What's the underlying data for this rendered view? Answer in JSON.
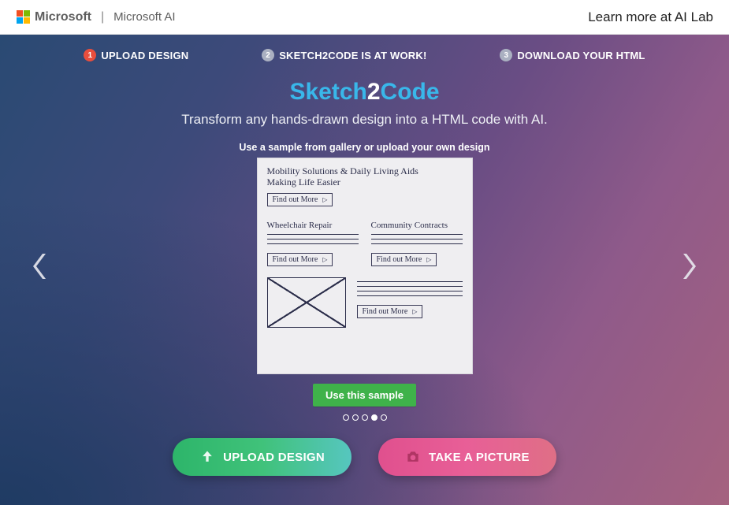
{
  "header": {
    "brand": "Microsoft",
    "subbrand": "Microsoft AI",
    "learn_more": "Learn more at AI Lab"
  },
  "steps": [
    {
      "num": "1",
      "label": "UPLOAD DESIGN",
      "active": true
    },
    {
      "num": "2",
      "label": "SKETCH2CODE IS AT WORK!",
      "active": false
    },
    {
      "num": "3",
      "label": "DOWNLOAD YOUR HTML",
      "active": false
    }
  ],
  "title": {
    "p1": "Sketch",
    "p2": "2",
    "p3": "Code"
  },
  "subtitle": "Transform any hands-drawn design into a HTML code with AI.",
  "gallery_hint": "Use a sample from gallery or upload your own design",
  "sketch": {
    "heading_l1": "Mobility Solutions & Daily Living Aids",
    "heading_l2": "Making Life Easier",
    "cta": "Find out More",
    "col1_h": "Wheelchair Repair",
    "col2_h": "Community Contracts"
  },
  "use_sample_label": "Use this sample",
  "carousel": {
    "count": 5,
    "active_index": 3
  },
  "actions": {
    "upload_label": "UPLOAD DESIGN",
    "camera_label": "TAKE A PICTURE"
  }
}
